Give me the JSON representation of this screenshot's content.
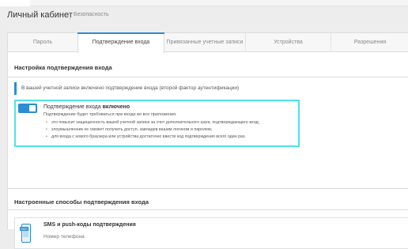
{
  "header": {
    "title": "Личный кабинет",
    "breadcrumb": "Безопасность"
  },
  "tabs": [
    {
      "label": "Пароль",
      "active": false
    },
    {
      "label": "Подтверждение входа",
      "active": true
    },
    {
      "label": "Привязанные учетные записи",
      "active": false
    },
    {
      "label": "Устройства",
      "active": false
    },
    {
      "label": "Разрешения",
      "active": false
    }
  ],
  "login_confirmation": {
    "section_title": "Настройка подтверждения входа",
    "info_text": "В вашей учетной записи включено подтверждение входа (второй фактор аутентификации)",
    "toggle_state": "on",
    "toggle_title_prefix": "Подтверждение входа",
    "toggle_title_status": "включено",
    "description": "Подтверждение будет требоваться при входе во все приложения.",
    "bullets": [
      "это повысит защищенность вашей учетной записи за счет дополнительного шага, подтверждающего вход;",
      "злоумышленник не сможет получить доступ, завладев вашим логином и паролем;",
      "для входа с нового браузера или устройства достаточно ввести код подтверждения всего один раз."
    ]
  },
  "methods": {
    "section_title": "Настроенные способы подтверждения входа",
    "items": [
      {
        "icon": "phone-sms-icon",
        "icon_badge": "SMS",
        "title": "SMS и push-коды подтверждения",
        "subtitle": "Номер телефона"
      }
    ]
  },
  "colors": {
    "accent": "#2b8dd6",
    "highlight_border": "#4fe3e6"
  }
}
